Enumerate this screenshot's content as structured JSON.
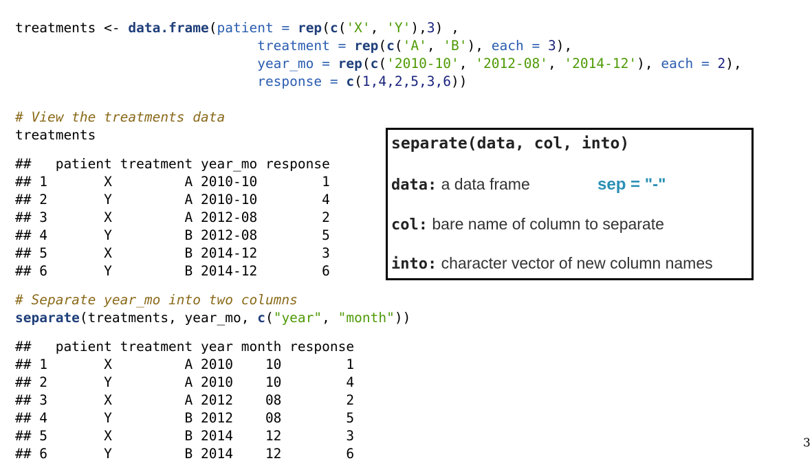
{
  "code_block_1": {
    "line1": {
      "obj": "treatments",
      "assign": " <- ",
      "fn": "data.frame",
      "open": "(",
      "arg1": "patient",
      "eq": " = ",
      "fn_rep": "rep",
      "fn_c": "c",
      "s1": "'X'",
      "comma": ", ",
      "s2": "'Y'",
      "close": "),",
      "n": "3",
      "tail": ") ,"
    },
    "line2": {
      "indent": "                              ",
      "arg": "treatment",
      "eq": " = ",
      "fn_rep": "rep",
      "fn_c": "c",
      "s1": "'A'",
      "comma": ", ",
      "s2": "'B'",
      "mid": "), ",
      "each": "each",
      "eq2": " = ",
      "n": "3",
      "tail": "),"
    },
    "line3": {
      "indent": "                              ",
      "arg": "year_mo",
      "eq": " = ",
      "fn_rep": "rep",
      "fn_c": "c",
      "s1": "'2010-10'",
      "s2": "'2012-08'",
      "s3": "'2014-12'",
      "comma": ", ",
      "mid": "), ",
      "each": "each",
      "eq2": " = ",
      "n": "2",
      "tail": "),"
    },
    "line4": {
      "indent": "                              ",
      "arg": "response",
      "eq": " = ",
      "fn_c": "c",
      "vals": "1,4,2,5,3,6",
      "tail": "))"
    }
  },
  "comment_view": "# View the treatments data",
  "print_obj": "treatments",
  "table1": {
    "header": "##   patient treatment year_mo response",
    "rows": [
      "## 1       X         A 2010-10        1",
      "## 2       Y         A 2010-10        4",
      "## 3       X         A 2012-08        2",
      "## 4       Y         B 2012-08        5",
      "## 5       X         B 2014-12        3",
      "## 6       Y         B 2014-12        6"
    ]
  },
  "comment_separate": "# Separate year_mo into two columns",
  "separate_call": {
    "fn": "separate",
    "args": "(treatments, year_mo, ",
    "fn_c": "c",
    "open": "(",
    "s1": "\"year\"",
    "comma": ", ",
    "s2": "\"month\"",
    "close": "))"
  },
  "table2": {
    "header": "##   patient treatment year month response",
    "rows": [
      "## 1       X         A 2010    10        1",
      "## 2       Y         A 2010    10        4",
      "## 3       X         A 2012    08        2",
      "## 4       Y         B 2012    08        5",
      "## 5       X         B 2014    12        3",
      "## 6       Y         B 2014    12        6"
    ]
  },
  "info_box": {
    "signature": "separate(data, col, into)",
    "data_term": "data:",
    "data_desc": " a data frame",
    "sep_note": "sep = \"-\"",
    "col_term": "col:",
    "col_desc": " bare name of column to separate",
    "into_term": "into:",
    "into_desc": " character vector of new column names"
  },
  "page_number": "3"
}
